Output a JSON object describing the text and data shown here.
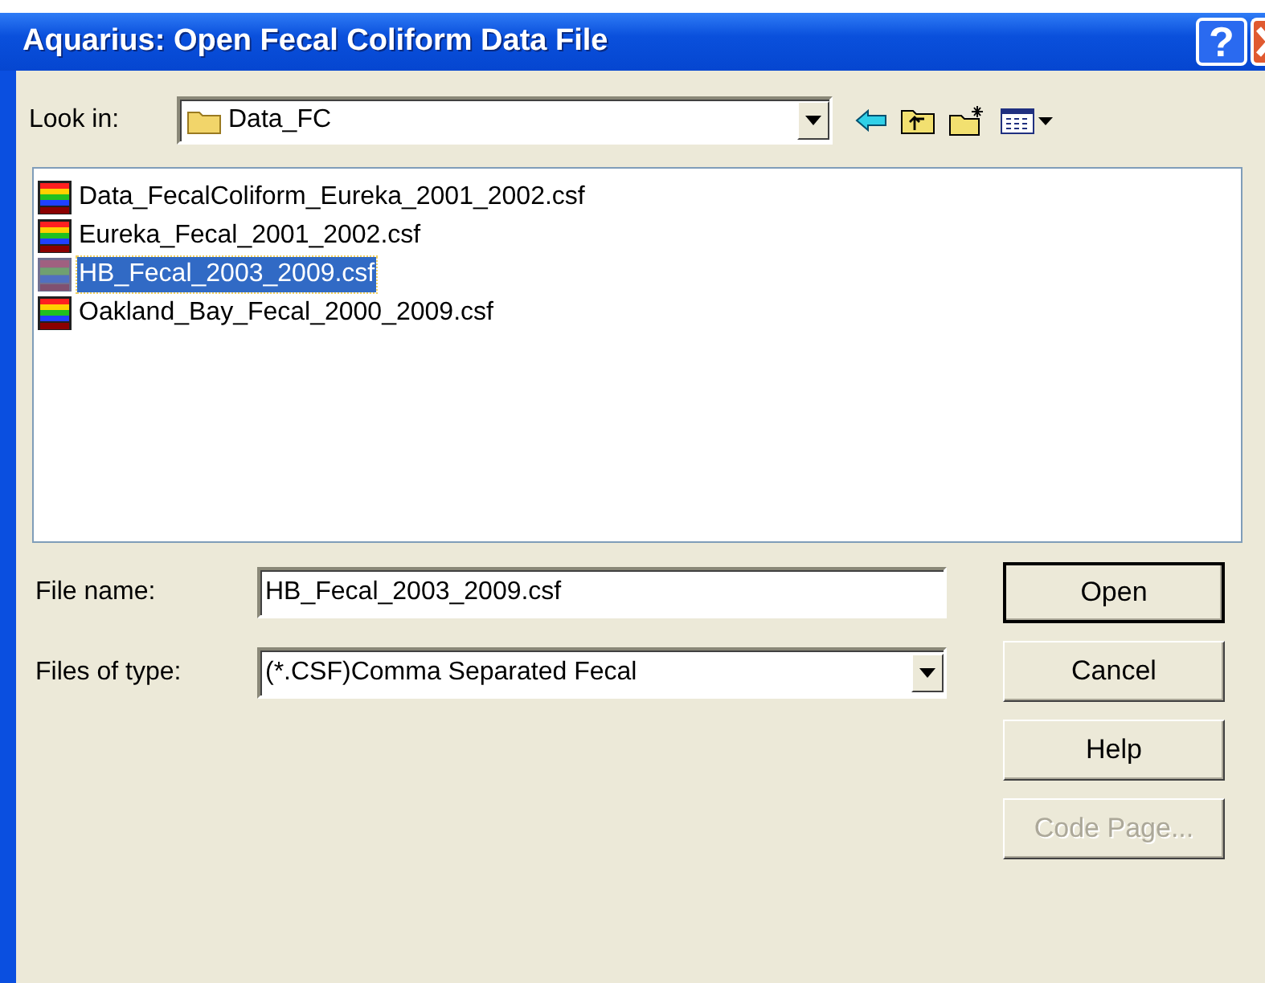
{
  "window": {
    "title": "Aquarius: Open Fecal Coliform Data File",
    "help_glyph": "?"
  },
  "look_in": {
    "label": "Look in:",
    "value": "Data_FC"
  },
  "files": [
    {
      "name": "Data_FecalColiform_Eureka_2001_2002.csf",
      "selected": false
    },
    {
      "name": "Eureka_Fecal_2001_2002.csf",
      "selected": false
    },
    {
      "name": "HB_Fecal_2003_2009.csf",
      "selected": true
    },
    {
      "name": "Oakland_Bay_Fecal_2000_2009.csf",
      "selected": false
    }
  ],
  "file_name": {
    "label": "File name:",
    "value": "HB_Fecal_2003_2009.csf"
  },
  "file_type": {
    "label": "Files of type:",
    "value": "(*.CSF)Comma Separated Fecal"
  },
  "buttons": [
    {
      "label": "Open",
      "default": true,
      "disabled": false
    },
    {
      "label": "Cancel",
      "default": false,
      "disabled": false
    },
    {
      "label": "Help",
      "default": false,
      "disabled": false
    },
    {
      "label": "Code Page...",
      "default": false,
      "disabled": true
    }
  ]
}
